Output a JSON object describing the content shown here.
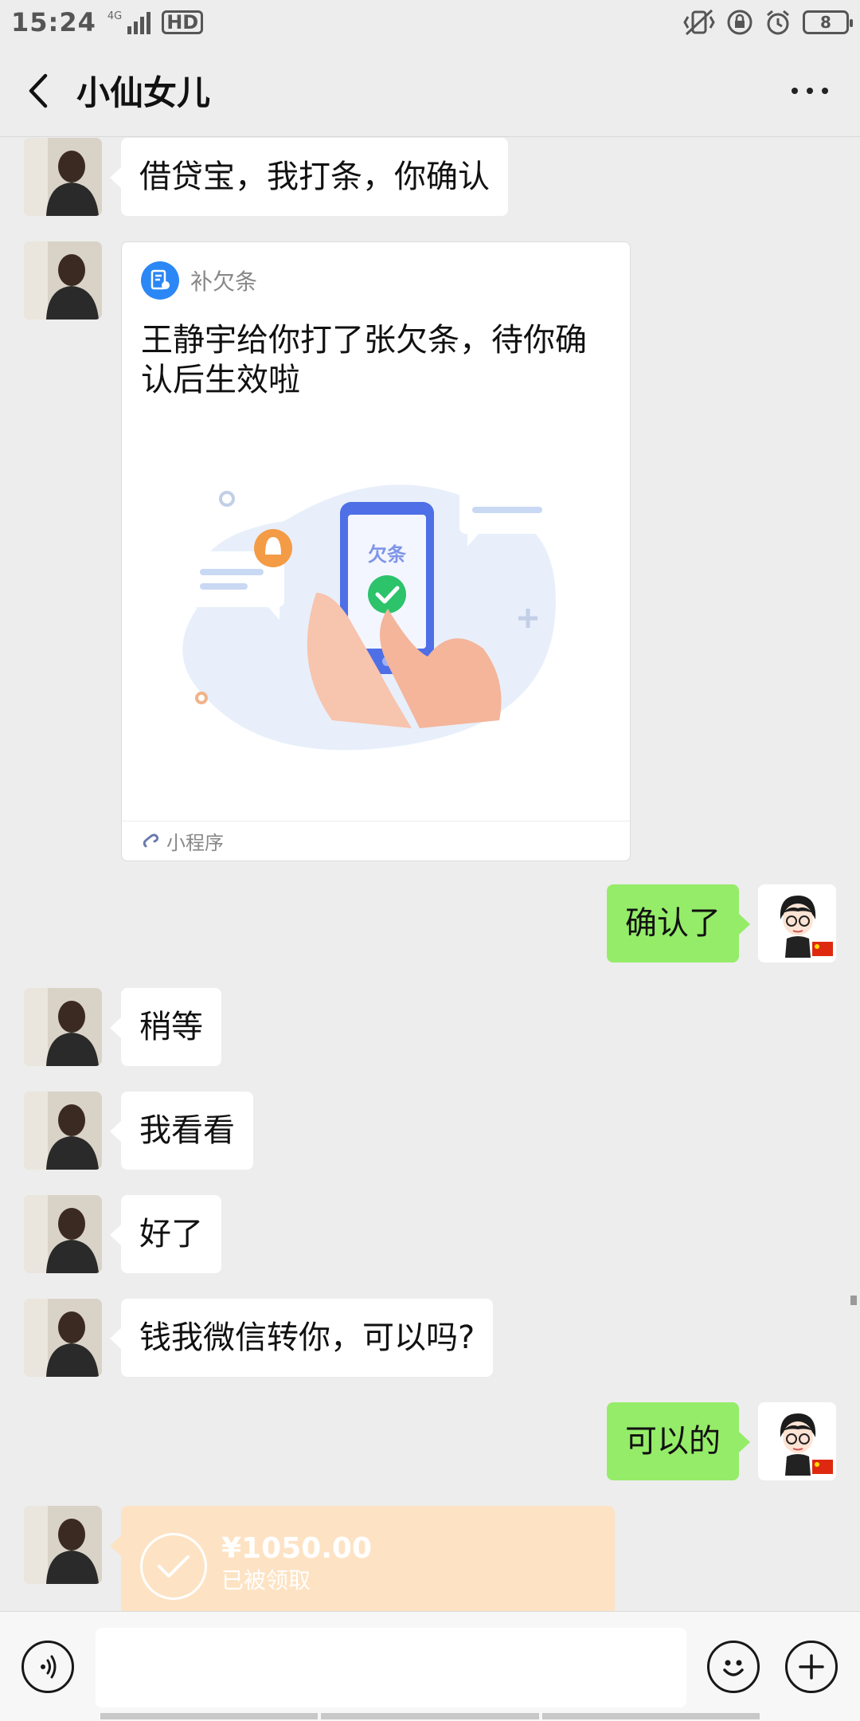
{
  "status_bar": {
    "time": "15:24",
    "network_type": "4G",
    "hd_label": "HD",
    "battery_level": "8"
  },
  "header": {
    "title": "小仙女儿"
  },
  "messages": [
    {
      "side": "left",
      "type": "text",
      "text": "借贷宝，我打条，你确认"
    },
    {
      "side": "left",
      "type": "mini_program",
      "app_name": "补欠条",
      "text": "王静宇给你打了张欠条，待你确认后生效啦",
      "illustration_label": "欠条",
      "footer_label": "小程序"
    },
    {
      "side": "right",
      "type": "text",
      "text": "确认了"
    },
    {
      "side": "left",
      "type": "text",
      "text": "稍等"
    },
    {
      "side": "left",
      "type": "text",
      "text": "我看看"
    },
    {
      "side": "left",
      "type": "text",
      "text": "好了"
    },
    {
      "side": "left",
      "type": "text",
      "text": "钱我微信转你，可以吗?"
    },
    {
      "side": "right",
      "type": "text",
      "text": "可以的"
    },
    {
      "side": "left",
      "type": "transfer",
      "amount": "¥1050.00",
      "status": "已被领取"
    }
  ],
  "input_bar": {
    "placeholder": "",
    "voice_icon": "voice-icon",
    "emoji_icon": "emoji-icon",
    "plus_icon": "plus-icon"
  },
  "colors": {
    "background": "#ededed",
    "bubble_self": "#95ec69",
    "bubble_other": "#ffffff",
    "transfer_card": "#fde3c4",
    "mini_program_icon": "#2b87f5"
  }
}
